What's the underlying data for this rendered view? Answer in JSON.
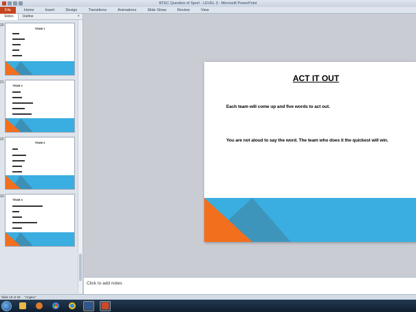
{
  "window": {
    "title": "BTEC Question of Sport - LEVEL 3 - Microsoft PowerPoint"
  },
  "ribbon": {
    "tabs": [
      {
        "label": "File"
      },
      {
        "label": "Home"
      },
      {
        "label": "Insert"
      },
      {
        "label": "Design"
      },
      {
        "label": "Transitions"
      },
      {
        "label": "Animations"
      },
      {
        "label": "Slide Show"
      },
      {
        "label": "Review"
      },
      {
        "label": "View"
      }
    ]
  },
  "slide_pane": {
    "tabs": [
      {
        "label": "Slides"
      },
      {
        "label": "Outline"
      }
    ],
    "close_glyph": "×",
    "thumbnails": [
      {
        "number": "20",
        "title": "TEAM 1"
      },
      {
        "number": "21",
        "title": "TEAM 2"
      },
      {
        "number": "22",
        "title": "TEAM 3"
      },
      {
        "number": "23",
        "title": "TEAM 4"
      }
    ]
  },
  "slide": {
    "title": "ACT IT OUT",
    "line1": "Each team will come up and five words to act out.",
    "line2": "You are not aloud to say the word. The team who does it the quickest will win."
  },
  "notes": {
    "placeholder": "Click to add notes"
  },
  "status_bar": {
    "slide_indicator": "Slide 19 of 29",
    "theme": "\"Angles\""
  },
  "colors": {
    "orange": "#f26f1e",
    "blue": "#3aaee0",
    "dark_blue": "#3e95bc",
    "file_tab": "#c5451e"
  },
  "taskbar": {
    "icons": [
      "start-orb",
      "explorer-icon",
      "media-player-icon",
      "chrome-icon",
      "internet-explorer-icon",
      "word-icon",
      "powerpoint-icon"
    ]
  }
}
